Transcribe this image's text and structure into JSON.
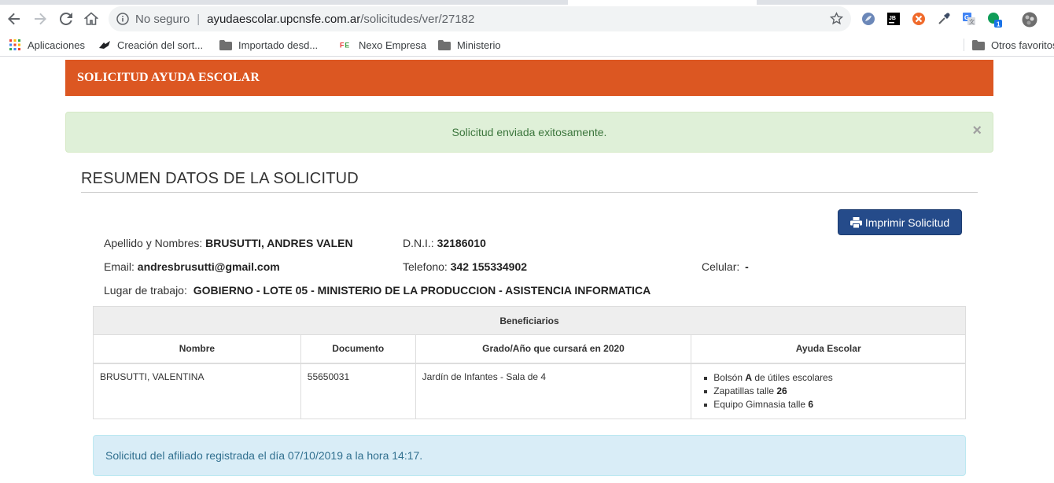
{
  "browser": {
    "security_label": "No seguro",
    "url_host": "ayudaescolar.upcnsfe.com.ar",
    "url_path": "/solicitudes/ver/27182",
    "extensions": [
      "privacy-badger-icon",
      "jb-icon",
      "noscript-icon",
      "eyedropper-icon",
      "translate-icon",
      "hangouts-icon",
      "profile-avatar-icon"
    ],
    "extension_badge": "1",
    "bookmarks": [
      {
        "label": "Aplicaciones",
        "icon": "apps-grid-icon"
      },
      {
        "label": "Creación del sort...",
        "icon": "bird-icon"
      },
      {
        "label": "Importado desd...",
        "icon": "folder-icon"
      },
      {
        "label": "Nexo Empresa",
        "icon": "fe-logo-icon"
      },
      {
        "label": "Ministerio",
        "icon": "folder-icon"
      }
    ],
    "other_bookmarks": "Otros favoritos"
  },
  "page": {
    "header_title": "SOLICITUD AYUDA ESCOLAR",
    "success_message": "Solicitud enviada exitosamente.",
    "close_symbol": "×",
    "section_title": "RESUMEN DATOS DE LA SOLICITUD",
    "print_button": "Imprimir Solicitud",
    "fields": {
      "name_label": "Apellido y Nombres:",
      "name_value": "BRUSUTTI, ANDRES VALEN",
      "dni_label": "D.N.I.:",
      "dni_value": "32186010",
      "email_label": "Email:",
      "email_value": "andresbrusutti@gmail.com",
      "phone_label": "Telefono:",
      "phone_value": "342 155334902",
      "cell_label": "Celular:",
      "cell_value": "-",
      "workplace_label": "Lugar de trabajo:",
      "workplace_value": "GOBIERNO - LOTE 05 - MINISTERIO DE LA PRODUCCION - ASISTENCIA INFORMATICA"
    },
    "beneficiaries": {
      "title": "Beneficiarios",
      "columns": [
        "Nombre",
        "Documento",
        "Grado/Año que cursará en 2020",
        "Ayuda Escolar"
      ],
      "rows": [
        {
          "name": "BRUSUTTI, VALENTINA",
          "document": "55650031",
          "grade": "Jardín de Infantes - Sala de 4",
          "aid": [
            {
              "prefix": "Bolsón ",
              "bold": "A",
              "suffix": " de útiles escolares"
            },
            {
              "prefix": "Zapatillas talle ",
              "bold": "26",
              "suffix": ""
            },
            {
              "prefix": "Equipo Gimnasia talle ",
              "bold": "6",
              "suffix": ""
            }
          ]
        }
      ]
    },
    "info_message": "Solicitud del afiliado registrada el día 07/10/2019 a la hora 14:17."
  },
  "colors": {
    "header_orange": "#dc5722",
    "print_button_blue": "#254b8a",
    "success_bg": "#dff0d8",
    "info_bg": "#d9edf7"
  }
}
